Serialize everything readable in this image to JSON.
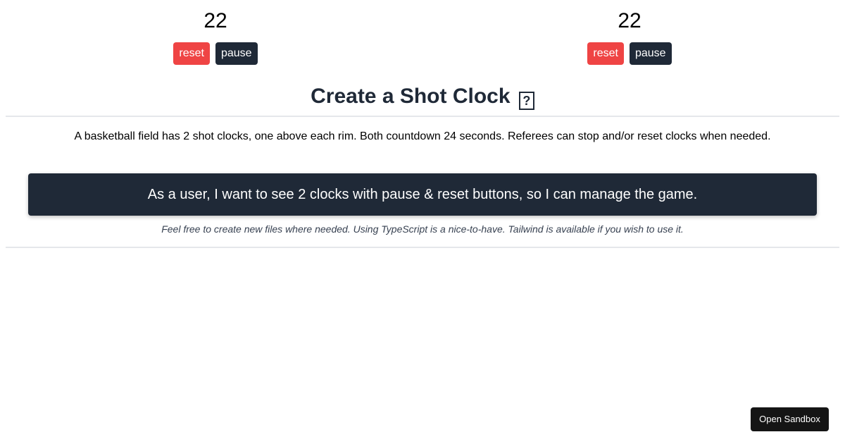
{
  "clocks": [
    {
      "value": "22",
      "reset_label": "reset",
      "pause_label": "pause"
    },
    {
      "value": "22",
      "reset_label": "reset",
      "pause_label": "pause"
    }
  ],
  "header": {
    "title": "Create a Shot Clock",
    "title_glyph": "?"
  },
  "content": {
    "description": "A basketball field has 2 shot clocks, one above each rim. Both countdown 24 seconds. Referees can stop and/or reset clocks when needed.",
    "user_story": "As a user, I want to see 2 clocks with pause & reset buttons, so I can manage the game.",
    "note": "Feel free to create new files where needed. Using TypeScript is a nice-to-have. Tailwind is available if you wish to use it."
  },
  "sandbox": {
    "label": "Open Sandbox"
  },
  "colors": {
    "reset": "#ef4444",
    "pause": "#1f2937",
    "story_bg": "#1f2937",
    "sandbox_bg": "#151515"
  }
}
